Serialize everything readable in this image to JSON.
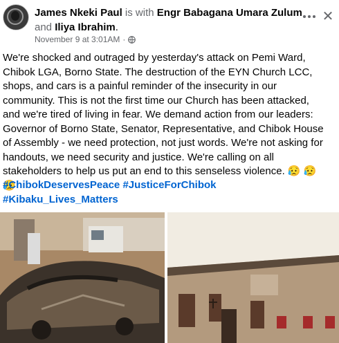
{
  "post": {
    "author": "James Nkeki Paul",
    "with_text": "is with",
    "tag1": "Engr Babagana Umara Zulum",
    "and_text": "and",
    "tag2": "Iliya Ibrahim",
    "period": ".",
    "date": "November 9 at 3:01AM",
    "separator": "·",
    "body": "We're shocked and outraged by yesterday's attack on Pemi Ward, Chibok LGA, Borno State. The destruction of the EYN Church LCC, shops, and cars is a painful reminder of the insecurity in our community. This is not the first time our Church has been attacked, and we're tired of living in fear. We demand action from our leaders: Governor of Borno State, Senator, Representative, and Chibok House of Assembly - we need protection, not just words. We're not asking for handouts, we need security and justice. We're calling on all stakeholders to help us put an end to this senseless violence. 😥 😥 😥",
    "hashtags": [
      "#ChibokDeservesPeace",
      "#JusticeForChibok",
      "#Kibaku_Lives_Matters"
    ]
  },
  "icons": {
    "more": "more-horizontal-icon",
    "close": "close-icon",
    "privacy": "globe-icon"
  },
  "colors": {
    "link": "#0064d1",
    "muted": "#65676b",
    "text": "#050505"
  }
}
